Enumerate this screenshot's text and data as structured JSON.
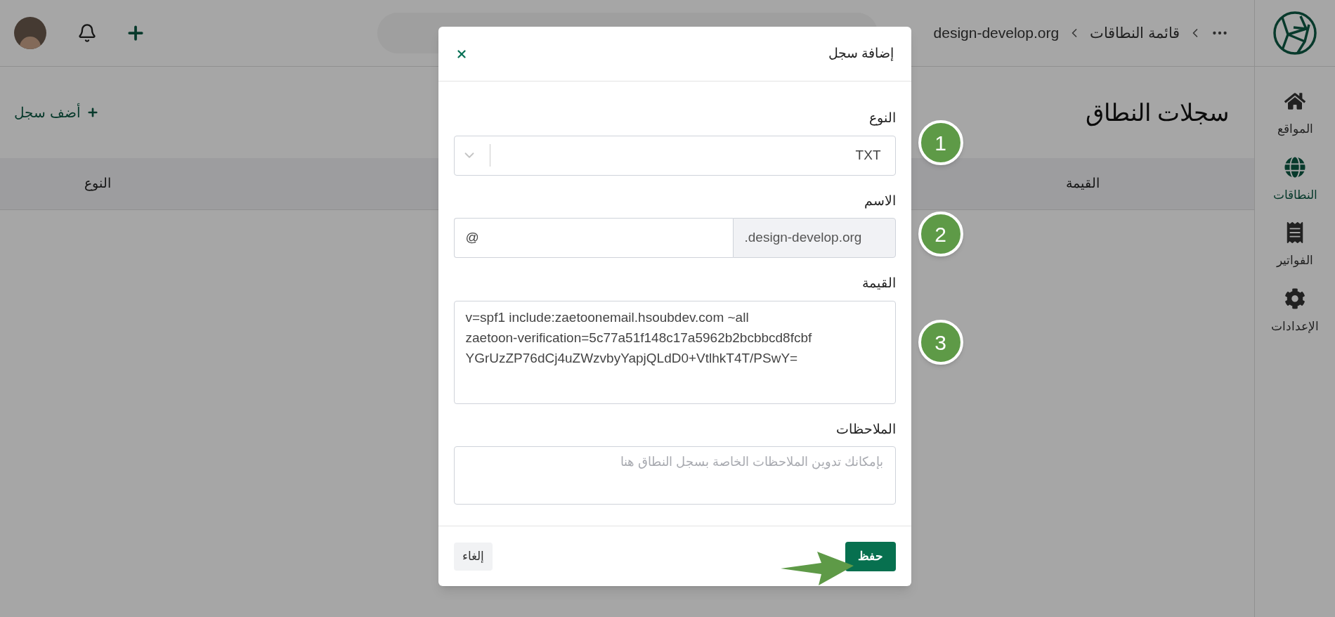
{
  "sidebar": {
    "items": [
      {
        "label": "المواقع",
        "selected": false
      },
      {
        "label": "النطاقات",
        "selected": true
      },
      {
        "label": "الفواتير",
        "selected": false
      },
      {
        "label": "الإعدادات",
        "selected": false
      }
    ]
  },
  "header": {
    "breadcrumbs": [
      "قائمة النطاقات",
      "design-develop.org"
    ]
  },
  "page": {
    "title": "سجلات النطاق",
    "add_button": "أضف سجل",
    "table": {
      "columns": [
        "القيمة",
        "النوع"
      ]
    }
  },
  "dialog": {
    "title": "إضافة سجل",
    "fields": [
      {
        "kind": "select",
        "label": "النوع",
        "value": "TXT"
      },
      {
        "kind": "suffix",
        "label": "الاسم",
        "addon": ".design-develop.org",
        "value": "@"
      },
      {
        "kind": "textarea",
        "label": "القيمة",
        "value": "v=spf1 include:zaetoonemail.hsoubdev.com ~all\nzaetoon-verification=5c77a51f148c17a5962b2bcbbcd8fcbf\nYGrUzZP76dCj4uZWzvbyYapjQLdD0+VtlhkT4T/PSwY="
      },
      {
        "kind": "textarea",
        "label": "الملاحظات",
        "placeholder": "بإمكانك تدوين الملاحظات الخاصة بسجل النطاق هنا"
      }
    ],
    "buttons": [
      {
        "label": "حفظ",
        "kind": "primary"
      },
      {
        "label": "إلغاء",
        "kind": "secondary"
      }
    ]
  },
  "annotations": {
    "markers": [
      "1",
      "2",
      "3"
    ]
  }
}
